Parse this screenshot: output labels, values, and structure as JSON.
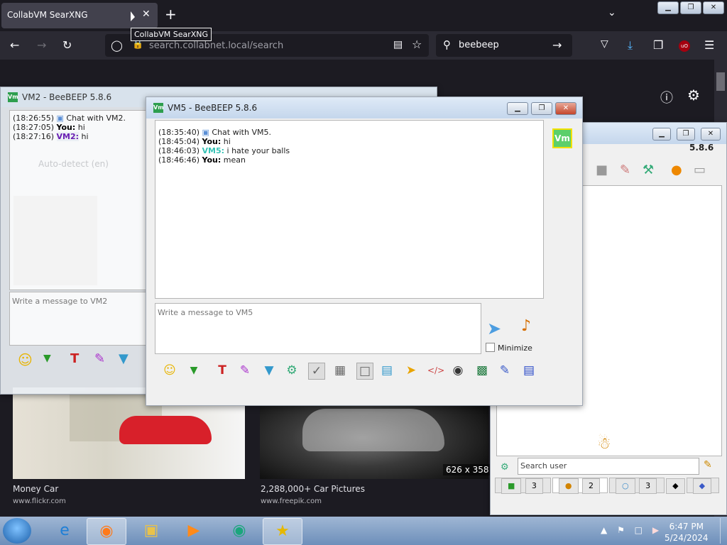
{
  "browser": {
    "tab_title": "CollabVM SearXNG",
    "tab_close": "✕",
    "new_tab": "+",
    "tooltip": "CollabVM SearXNG",
    "url_host": "search.collabnet.local",
    "url_path": "/search",
    "search_query": "beebeep",
    "window_controls": [
      "▁",
      "❐",
      "✕"
    ]
  },
  "results": [
    {
      "title": "Money Car",
      "source": "www.flickr.com"
    },
    {
      "title": "2,288,000+ Car Pictures",
      "source": "www.freepik.com",
      "dimensions": "626 x 358"
    }
  ],
  "vm2_window": {
    "title": "VM2 - BeeBEEP 5.8.6",
    "messages": [
      {
        "time": "(18:26:55)",
        "sender": "",
        "text": "Chat with VM2."
      },
      {
        "time": "(18:27:05)",
        "sender": "You:",
        "text": "hi"
      },
      {
        "time": "(18:27:16)",
        "sender": "VM2:",
        "text": "hi"
      }
    ],
    "placeholder": "Write a message to VM2",
    "ghost_text": "Auto-detect (en)"
  },
  "vm5_window": {
    "title": "VM5 - BeeBEEP 5.8.6",
    "avatar": "Vm",
    "messages": [
      {
        "time": "(18:35:40)",
        "sender": "",
        "text": "Chat with VM5."
      },
      {
        "time": "(18:45:04)",
        "sender": "You:",
        "text": "hi"
      },
      {
        "time": "(18:46:03)",
        "sender": "VM5:",
        "text": "i hate your balls"
      },
      {
        "time": "(18:46:46)",
        "sender": "You:",
        "text": "mean"
      }
    ],
    "placeholder": "Write a message to VM5",
    "minimize_label": "Minimize"
  },
  "main_window": {
    "version": "5.8.6",
    "search_placeholder": "Search user",
    "tabs": [
      "3",
      "2",
      "3"
    ]
  },
  "taskbar": {
    "time": "6:47 PM",
    "date": "5/24/2024"
  }
}
